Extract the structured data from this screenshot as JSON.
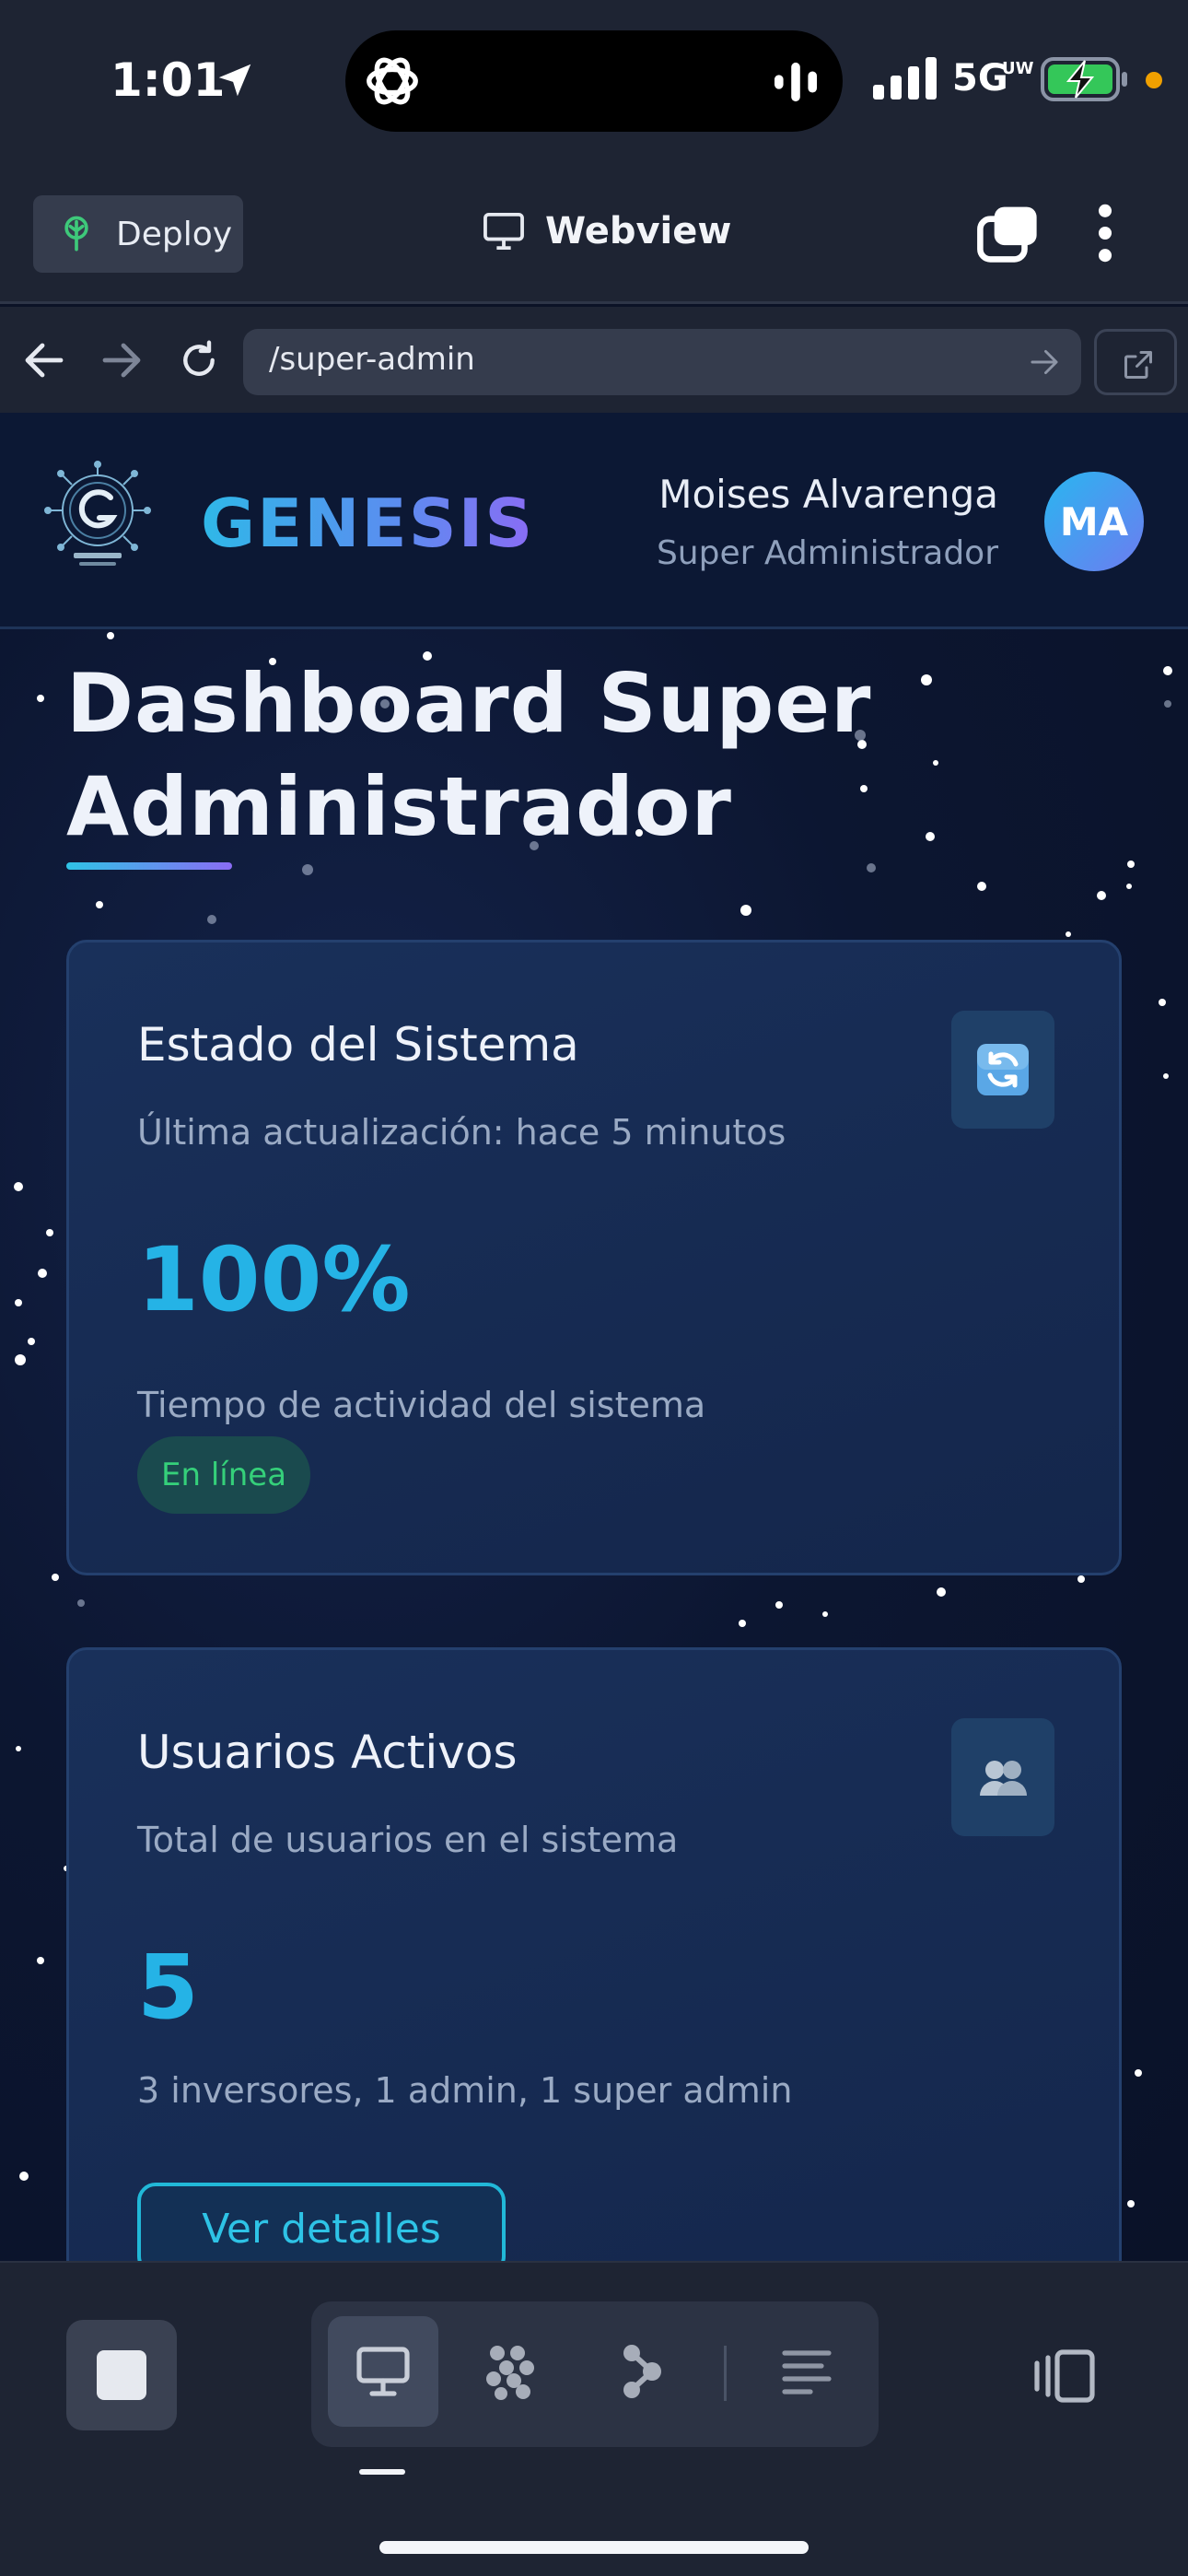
{
  "status_bar": {
    "time": "1:01",
    "network": "5G",
    "network_sub": "UW",
    "icons": [
      "location-arrow-icon",
      "chatgpt-icon",
      "audio-wave-icon",
      "signal-icon",
      "battery-charging-icon"
    ]
  },
  "toolbar": {
    "deploy_label": "Deploy",
    "title": "Webview",
    "icons": [
      "deploy-icon",
      "monitor-icon",
      "tabs-icon",
      "more-vertical-icon"
    ]
  },
  "url_bar": {
    "path": "/super-admin",
    "icons": [
      "back-arrow-icon",
      "forward-arrow-icon",
      "reload-icon",
      "go-arrow-icon",
      "open-external-icon"
    ]
  },
  "site": {
    "brand": "GENESIS",
    "user": {
      "name": "Moises Alvarenga",
      "role": "Super Administrador",
      "initials": "MA"
    },
    "page_title": "Dashboard Super Administrador",
    "cards": [
      {
        "title": "Estado del Sistema",
        "subtitle": "Última actualización: hace 5 minutos",
        "value": "100%",
        "description": "Tiempo de actividad del sistema",
        "badge": "En línea",
        "icon": "refresh-icon"
      },
      {
        "title": "Usuarios Activos",
        "subtitle": "Total de usuarios en el sistema",
        "value": "5",
        "description": "3 inversores, 1 admin, 1 super admin",
        "button": "Ver detalles",
        "icon": "users-icon"
      }
    ]
  },
  "bottom_bar": {
    "icons": [
      "stop-icon",
      "desktop-icon",
      "apps-grid-icon",
      "agent-icon",
      "console-lines-icon",
      "panel-toggle-icon"
    ]
  },
  "colors": {
    "accent": "#25b3e6",
    "online": "#35d07a",
    "chrome": "#1e2433",
    "page_bg": "#0b1226"
  }
}
